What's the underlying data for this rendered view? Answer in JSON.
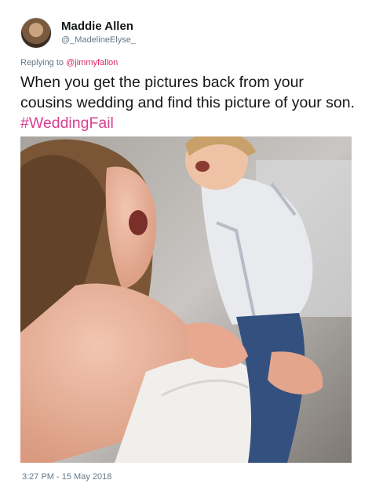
{
  "user": {
    "display_name": "Maddie Allen",
    "handle": "@_MadelineElyse_"
  },
  "reply": {
    "prefix": "Replying to",
    "mention": "@jimmyfallon"
  },
  "tweet": {
    "text": "When you get the pictures back from your cousins wedding and find this picture of your son.",
    "hashtag": "#WeddingFail",
    "timestamp": "3:27 PM - 15 May 2018"
  },
  "colors": {
    "name": "#14171a",
    "secondary": "#657786",
    "mention": "#e0245e",
    "hashtag": "#d93f8f"
  }
}
